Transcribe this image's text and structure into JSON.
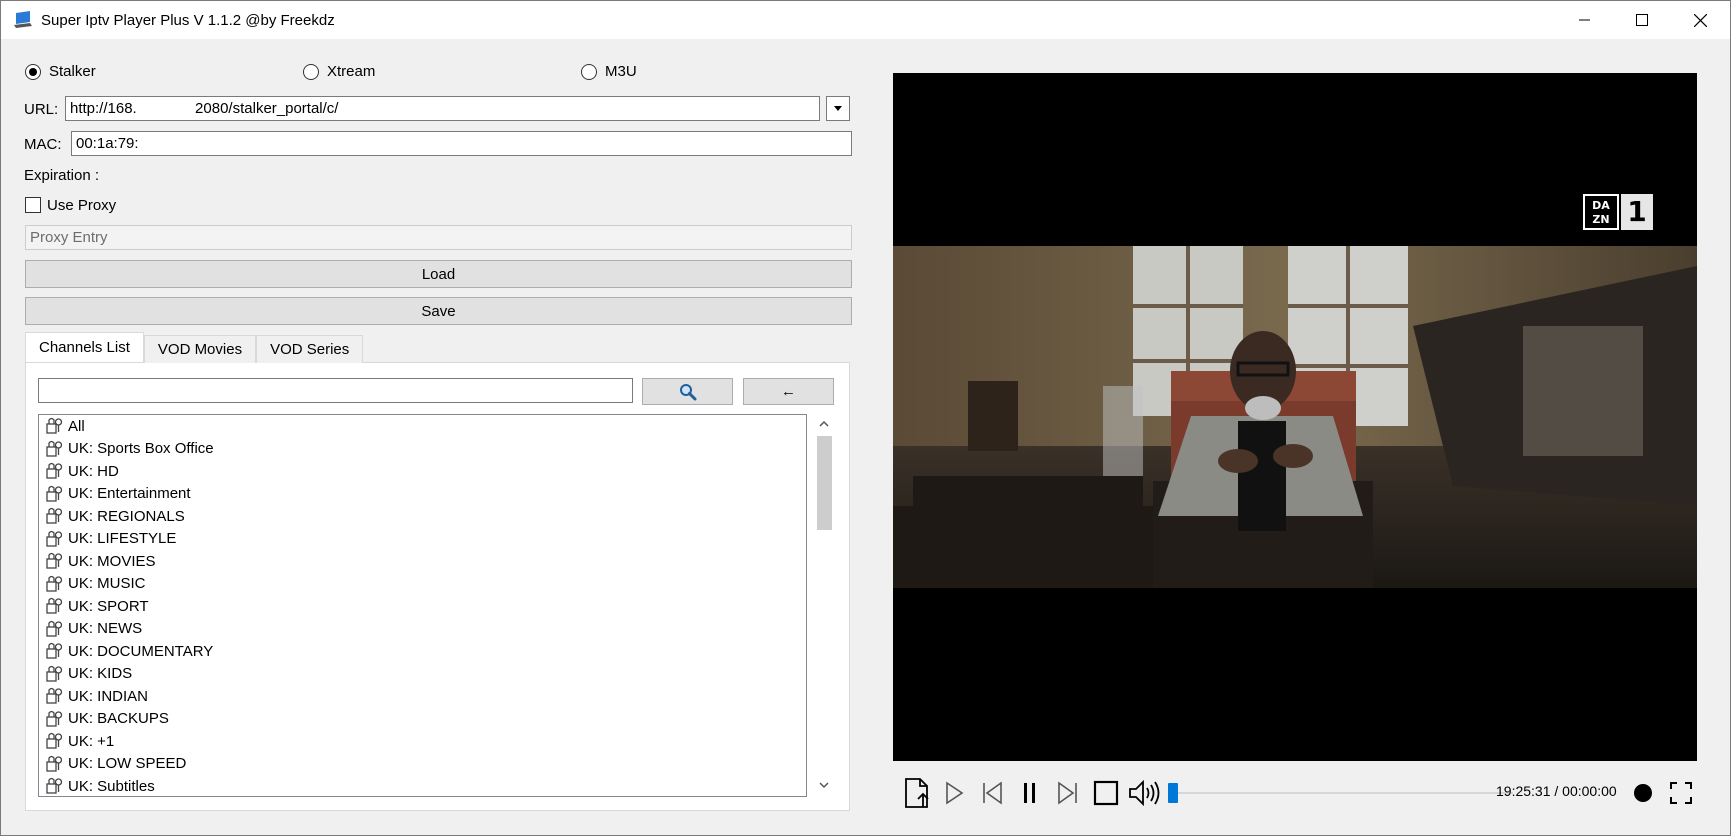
{
  "window": {
    "title": "Super Iptv Player Plus V 1.1.2 @by Freekdz"
  },
  "source_types": [
    {
      "label": "Stalker",
      "selected": true
    },
    {
      "label": "Xtream",
      "selected": false
    },
    {
      "label": "M3U",
      "selected": false
    }
  ],
  "url": {
    "label": "URL:",
    "value": "http://168.              2080/stalker_portal/c/"
  },
  "mac": {
    "label": "MAC:",
    "value": "00:1a:79:"
  },
  "expiration": {
    "label": "Expiration :"
  },
  "proxy": {
    "checkbox_label": "Use Proxy",
    "checked": false,
    "placeholder": "Proxy Entry"
  },
  "buttons": {
    "load": "Load",
    "save": "Save",
    "back": "←"
  },
  "tabs": [
    {
      "label": "Channels List",
      "active": true
    },
    {
      "label": "VOD Movies",
      "active": false
    },
    {
      "label": "VOD Series",
      "active": false
    }
  ],
  "search": {
    "value": ""
  },
  "channel_groups": [
    "All",
    "UK: Sports Box Office",
    "UK: HD",
    "UK: Entertainment",
    "UK: REGIONALS",
    "UK: LIFESTYLE",
    "UK: MOVIES",
    "UK: MUSIC",
    "UK: SPORT",
    "UK: NEWS",
    "UK: DOCUMENTARY",
    "UK: KIDS",
    "UK: INDIAN",
    "UK: BACKUPS",
    "UK: +1",
    "UK: LOW SPEED",
    "UK: Subtitles"
  ],
  "player": {
    "channel_logo": {
      "brand_top": "DA",
      "brand_bottom": "ZN",
      "number": "1"
    },
    "time_display": "19:25:31 / 00:00:00",
    "progress_fraction": 0.0
  },
  "colors": {
    "accent": "#0078d7",
    "window_bg": "#f0f0f0",
    "video_bg": "#000000"
  }
}
